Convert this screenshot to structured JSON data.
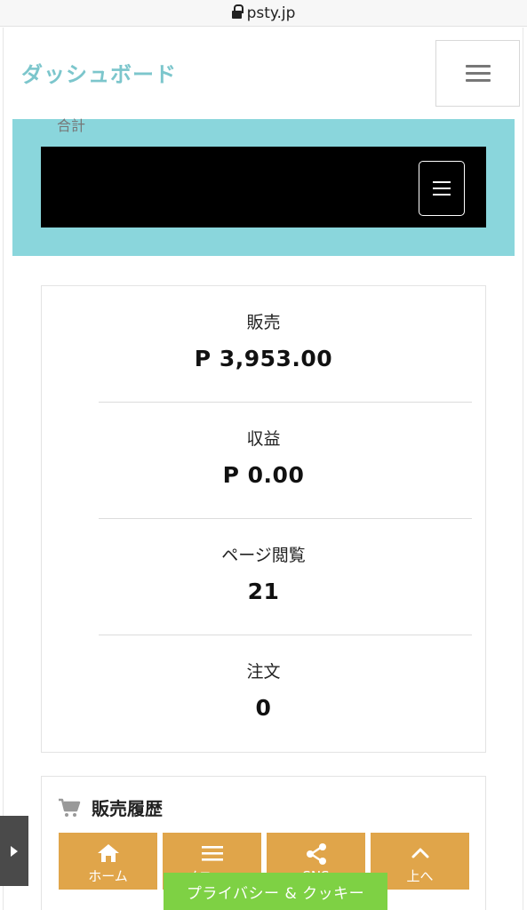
{
  "browser": {
    "url": "psty.jp"
  },
  "header": {
    "title": "ダッシュボード"
  },
  "stats": [
    {
      "label": "販売",
      "value": "P 3,953.00"
    },
    {
      "label": "収益",
      "value": "P 0.00"
    },
    {
      "label": "ページ閲覧",
      "value": "21"
    },
    {
      "label": "注文",
      "value": "0"
    }
  ],
  "sales_history": {
    "title": "販売履歴",
    "total_label": "合計"
  },
  "bottom_nav": [
    {
      "label": "ホーム",
      "icon": "home-icon"
    },
    {
      "label": "メニュー",
      "icon": "menu-icon"
    },
    {
      "label": "SNS",
      "icon": "share-icon"
    },
    {
      "label": "上へ",
      "icon": "chevron-up-icon"
    }
  ],
  "privacy_banner": {
    "label": "プライバシー & クッキー"
  },
  "colors": {
    "title": "#7cc6cc",
    "banner": "#8ad6dc",
    "nav": "#e0a54a",
    "privacy": "#7ed144"
  }
}
